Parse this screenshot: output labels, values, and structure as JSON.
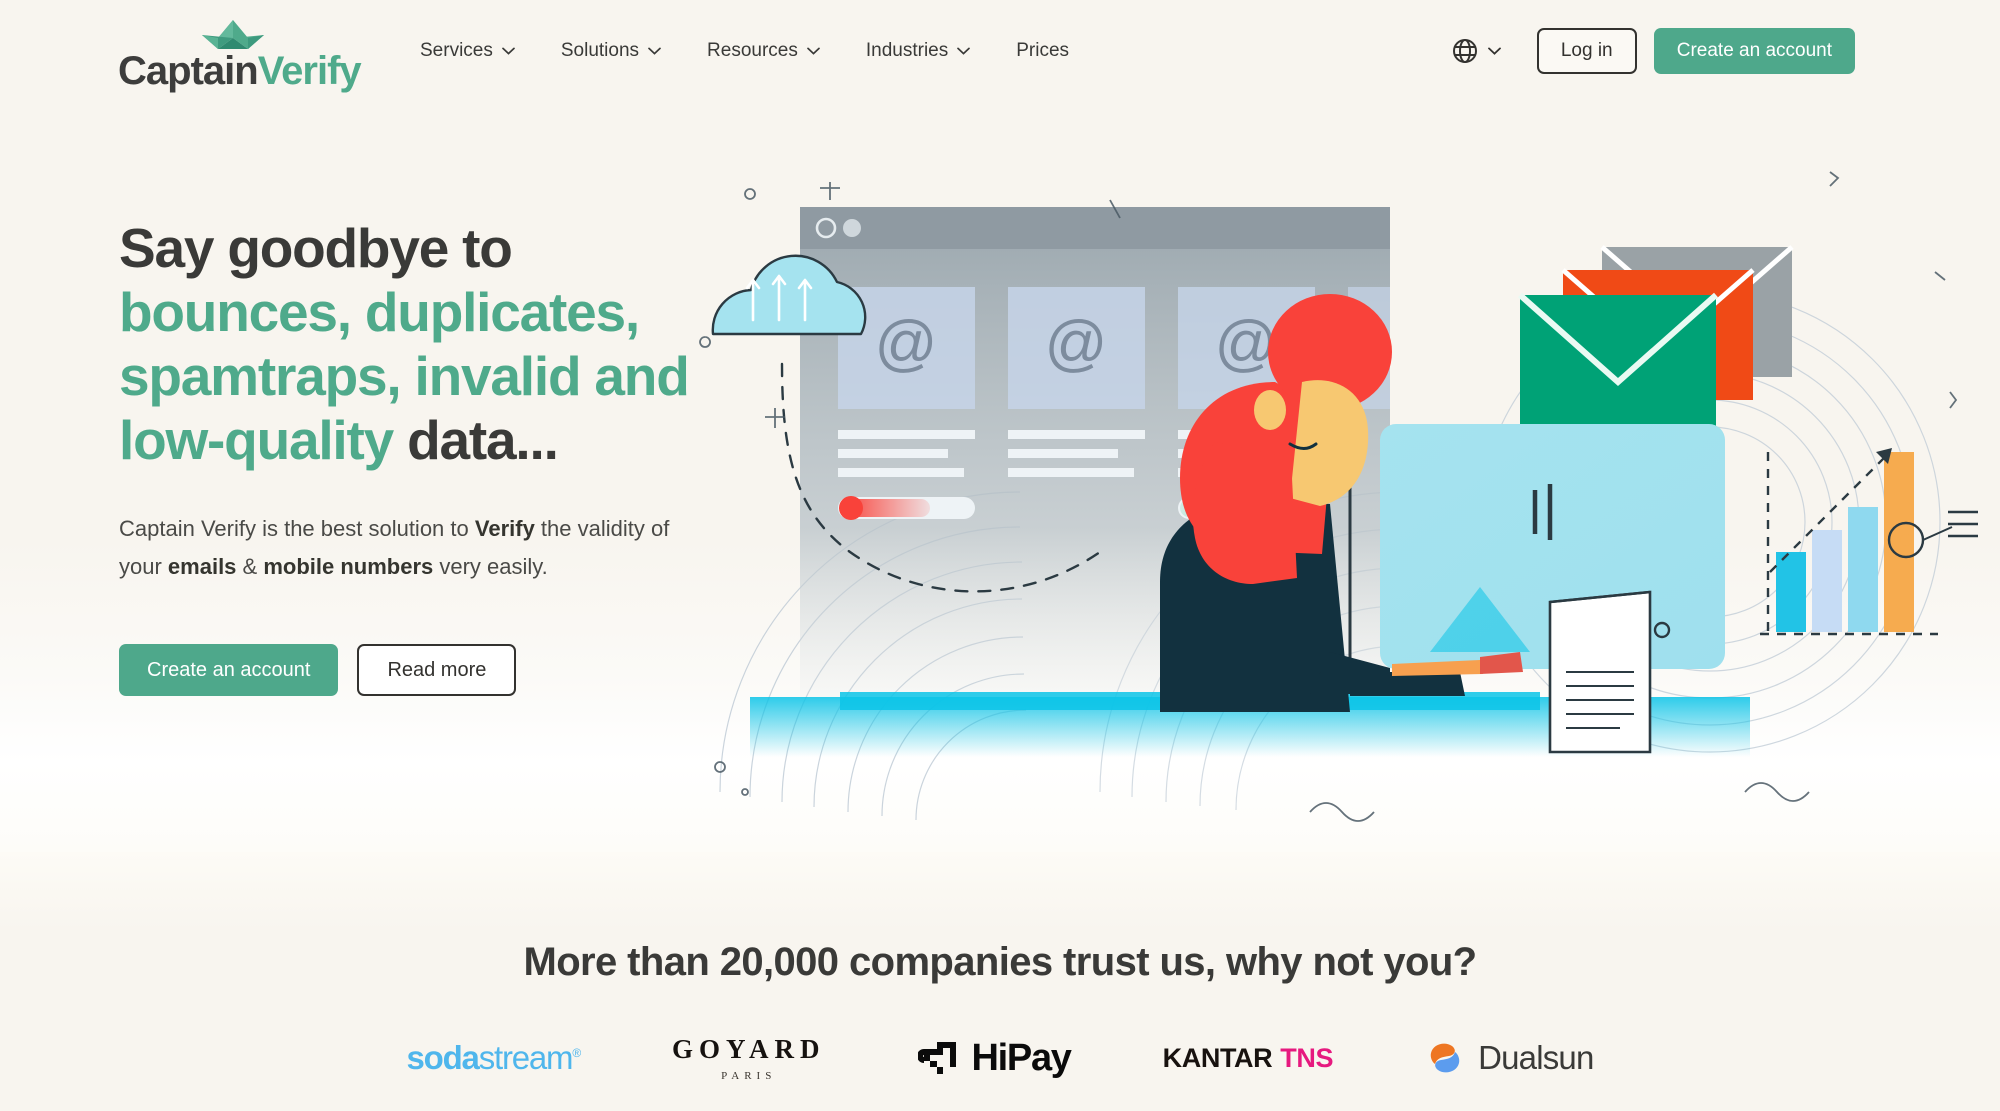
{
  "brand": {
    "logo_captain": "Captain",
    "logo_verify": "Verify",
    "accent_color": "#4ea88b",
    "dark_color": "#3a3a38",
    "background_color": "#f8f5ef"
  },
  "header": {
    "nav": [
      {
        "label": "Services",
        "has_chevron": true
      },
      {
        "label": "Solutions",
        "has_chevron": true
      },
      {
        "label": "Resources",
        "has_chevron": true
      },
      {
        "label": "Industries",
        "has_chevron": true
      },
      {
        "label": "Prices",
        "has_chevron": false
      }
    ],
    "language_icon": "globe-icon",
    "login_label": "Log in",
    "signup_label": "Create an account"
  },
  "hero": {
    "title_line1": "Say goodbye to",
    "title_green": "bounces, duplicates, spamtraps, invalid and low-quality",
    "title_end": "data...",
    "subtitle_part1": "Captain Verify is the best solution to ",
    "subtitle_bold1": "Verify",
    "subtitle_part2": " the validity of your ",
    "subtitle_bold2": "emails",
    "subtitle_part3": " & ",
    "subtitle_bold3": "mobile numbers",
    "subtitle_part4": " very easily.",
    "primary_button": "Create an account",
    "secondary_button": "Read more"
  },
  "trust": {
    "title": "More than 20,000 companies trust us, why not you?",
    "logos": [
      {
        "name": "sodastream",
        "part1": "soda",
        "part2": "stream",
        "mark": "®",
        "color": "#4fb6ec"
      },
      {
        "name": "goyard",
        "main": "GOYARD",
        "sub": "PARIS",
        "color": "#16120f"
      },
      {
        "name": "hipay",
        "text": "HiPay",
        "color": "#0b0b0b"
      },
      {
        "name": "kantar-tns",
        "part1": "KANTAR",
        "part2": "TNS",
        "color": "#e6197f"
      },
      {
        "name": "dualsun",
        "text": "Dualsun",
        "color": "#3a3a38"
      }
    ]
  },
  "illustration": {
    "alt": "woman at laptop verifying emails with cloud, browser window, envelopes and chart",
    "envelope_colors": [
      "#9aa2a6",
      "#f04a16",
      "#00a276"
    ],
    "chart_bar_colors": [
      "#22c3e6",
      "#c6dcf5",
      "#8fd9ef",
      "#f6ab4f"
    ],
    "hair_color": "#f9423a",
    "cloud_color": "#a5e3ef",
    "ground_color": "#0bc4e8"
  }
}
